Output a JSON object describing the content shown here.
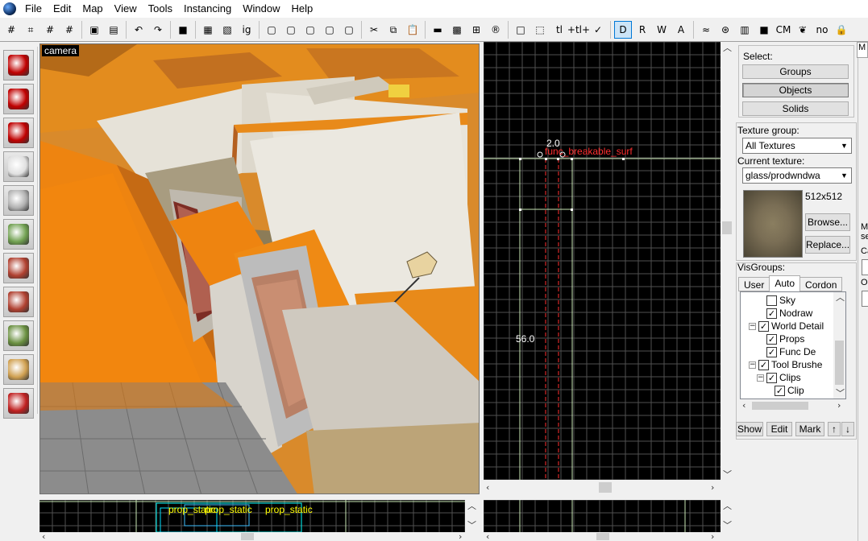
{
  "menu": [
    "File",
    "Edit",
    "Map",
    "View",
    "Tools",
    "Instancing",
    "Window",
    "Help"
  ],
  "toolbar": [
    {
      "icon": "grid-icon",
      "glyph": "#",
      "on": false
    },
    {
      "icon": "grid-size-icon",
      "glyph": "⌗",
      "on": false
    },
    {
      "icon": "grid-small-icon",
      "glyph": "#",
      "on": false
    },
    {
      "icon": "grid-highlight-icon",
      "glyph": "#",
      "on": false
    },
    {
      "sep": true
    },
    {
      "icon": "group-icon",
      "glyph": "▣",
      "on": false
    },
    {
      "icon": "ungroup-icon",
      "glyph": "▤",
      "on": false
    },
    {
      "sep": true
    },
    {
      "icon": "undo-icon",
      "glyph": "↶",
      "on": false
    },
    {
      "icon": "redo-icon",
      "glyph": "↷",
      "on": false
    },
    {
      "sep": true
    },
    {
      "icon": "carve-icon",
      "glyph": "■",
      "on": false
    },
    {
      "sep": true
    },
    {
      "icon": "to-entity-icon",
      "glyph": "▦",
      "on": false
    },
    {
      "icon": "to-world-icon",
      "glyph": "▧",
      "on": false
    },
    {
      "icon": "ignore-groups-icon",
      "glyph": "ig",
      "on": false
    },
    {
      "sep": true
    },
    {
      "icon": "hide-selected-icon",
      "glyph": "▢",
      "on": false
    },
    {
      "icon": "hide-unselected-icon",
      "glyph": "▢",
      "on": false
    },
    {
      "icon": "show-all-icon",
      "glyph": "▢",
      "on": false
    },
    {
      "icon": "visgroup-icon",
      "glyph": "▢",
      "on": false
    },
    {
      "icon": "cordon-icon",
      "glyph": "▢",
      "on": false
    },
    {
      "sep": true
    },
    {
      "icon": "cut-icon",
      "glyph": "✂",
      "on": false
    },
    {
      "icon": "copy-icon",
      "glyph": "⧉",
      "on": false
    },
    {
      "icon": "paste-icon",
      "glyph": "📋",
      "on": false
    },
    {
      "sep": true
    },
    {
      "icon": "texture-lock-icon",
      "glyph": "▬",
      "on": false
    },
    {
      "icon": "texture-scale-icon",
      "glyph": "▩",
      "on": false
    },
    {
      "icon": "apply-icon",
      "glyph": "⊞",
      "on": false
    },
    {
      "icon": "replace-icon",
      "glyph": "®",
      "on": false
    },
    {
      "sep": true
    },
    {
      "icon": "select-bounds-icon",
      "glyph": "□",
      "on": false
    },
    {
      "icon": "select-by-handles-icon",
      "glyph": "⬚",
      "on": false
    },
    {
      "icon": "tl-icon",
      "glyph": "tl",
      "on": false
    },
    {
      "icon": "helpers-icon",
      "glyph": "+tl+",
      "on": false
    },
    {
      "icon": "models-icon",
      "glyph": "✓",
      "on": false
    },
    {
      "sep": true
    },
    {
      "icon": "display-icon",
      "glyph": "D",
      "on": true
    },
    {
      "icon": "radius-icon",
      "glyph": "R",
      "on": false
    },
    {
      "icon": "wireframe-icon",
      "glyph": "W",
      "on": false
    },
    {
      "icon": "autoselect-icon",
      "glyph": "A",
      "on": false
    },
    {
      "sep": true
    },
    {
      "icon": "flat-icon",
      "glyph": "≈",
      "on": false
    },
    {
      "icon": "sphere-icon",
      "glyph": "⊛",
      "on": false
    },
    {
      "icon": "waffle-icon",
      "glyph": "▥",
      "on": false
    },
    {
      "icon": "cubes-icon",
      "glyph": "■",
      "on": false
    },
    {
      "icon": "cm-icon",
      "glyph": "CM",
      "on": false
    },
    {
      "icon": "leaf-icon",
      "glyph": "❦",
      "on": false
    },
    {
      "icon": "nodraw-icon",
      "glyph": "no",
      "on": false
    },
    {
      "icon": "lock-icon",
      "glyph": "🔒",
      "on": false
    }
  ],
  "tools": [
    {
      "name": "selection-tool-icon",
      "color": "#c00000"
    },
    {
      "name": "magnify-tool-icon",
      "color": "#c00000"
    },
    {
      "name": "camera-tool-icon",
      "color": "#c00000"
    },
    {
      "name": "entity-tool-icon",
      "color": "#e0e0e0"
    },
    {
      "name": "block-tool-icon",
      "color": "#b0b0b0"
    },
    {
      "name": "texture-application-icon",
      "color": "#70a050"
    },
    {
      "name": "apply-texture-icon",
      "color": "#b04030"
    },
    {
      "name": "decal-tool-icon",
      "color": "#b04030"
    },
    {
      "name": "overlay-tool-icon",
      "color": "#6a9040"
    },
    {
      "name": "clipping-tool-icon",
      "color": "#d0a050"
    },
    {
      "name": "vertex-tool-icon",
      "color": "#c02020"
    }
  ],
  "camera": {
    "label": "camera"
  },
  "view2d": {
    "entity_label": "func_breakable_surf",
    "width_label": "2.0",
    "height_label": "56.0"
  },
  "bottom_left": {
    "labels": [
      "prop_static",
      "prop_static",
      "prop_static"
    ]
  },
  "panel": {
    "select_label": "Select:",
    "select_buttons": [
      {
        "label": "Groups",
        "pressed": false
      },
      {
        "label": "Objects",
        "pressed": true
      },
      {
        "label": "Solids",
        "pressed": false
      }
    ],
    "texture_group_label": "Texture group:",
    "texture_group_value": "All Textures",
    "current_texture_label": "Current texture:",
    "current_texture_value": "glass/prodwndwa",
    "texture_size": "512x512",
    "browse_label": "Browse...",
    "replace_label": "Replace...",
    "visgroups_label": "VisGroups:",
    "tabs": [
      "User",
      "Auto",
      "Cordon"
    ],
    "active_tab": "Auto",
    "tree": [
      {
        "label": "Sky",
        "checked": false,
        "indent": 3,
        "expander": ""
      },
      {
        "label": "Nodraw",
        "checked": true,
        "indent": 3,
        "expander": ""
      },
      {
        "label": "World Detail",
        "checked": true,
        "indent": 2,
        "expander": "−"
      },
      {
        "label": "Props",
        "checked": true,
        "indent": 3,
        "expander": ""
      },
      {
        "label": "Func De",
        "checked": true,
        "indent": 3,
        "expander": ""
      },
      {
        "label": "Tool Brushe",
        "checked": true,
        "indent": 2,
        "expander": "−"
      },
      {
        "label": "Clips",
        "checked": true,
        "indent": 3,
        "expander": "−"
      },
      {
        "label": "Clip",
        "checked": true,
        "indent": 4,
        "expander": ""
      }
    ],
    "vg_buttons": [
      "Show",
      "Edit",
      "Mark",
      "↑",
      "↓"
    ],
    "edge_tab": "M",
    "edge_labels": [
      "Mo",
      "se",
      "Ca",
      "Ob"
    ]
  }
}
